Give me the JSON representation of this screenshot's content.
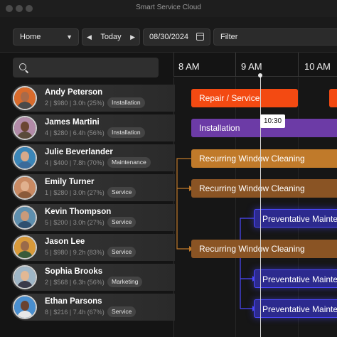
{
  "app": {
    "title": "Smart Service Cloud"
  },
  "toolbar": {
    "view_select": "Home",
    "today_label": "Today",
    "date_value": "08/30/2024",
    "filter_placeholder": "Filter"
  },
  "search": {
    "value": ""
  },
  "timeline": {
    "hours": [
      "8 AM",
      "9 AM",
      "10 AM"
    ],
    "current_time": "10:30"
  },
  "technicians": [
    {
      "name": "Andy Peterson",
      "stats": "2 | $980 | 3.0h (25%)",
      "tag": "Installation"
    },
    {
      "name": "James Martini",
      "stats": "4 | $280 | 6.4h (56%)",
      "tag": "Installation"
    },
    {
      "name": "Julie Beverlander",
      "stats": "4 | $400 | 7.8h (70%)",
      "tag": "Maintenance"
    },
    {
      "name": "Emily Turner",
      "stats": "1 | $280 | 3.0h (27%)",
      "tag": "Service"
    },
    {
      "name": "Kevin Thompson",
      "stats": "5 | $200 | 3.0h (27%)",
      "tag": "Service"
    },
    {
      "name": "Jason Lee",
      "stats": "5 | $980 | 9.2h (83%)",
      "tag": "Service"
    },
    {
      "name": "Sophia Brooks",
      "stats": "2 | $568 | 6.3h (56%)",
      "tag": "Marketing"
    },
    {
      "name": "Ethan Parsons",
      "stats": "8 | $216 | 7.4h (67%)",
      "tag": "Service"
    }
  ],
  "appointments": [
    {
      "label": "Repair / Service",
      "color": "#f34a12"
    },
    {
      "label": "Installation",
      "color": "#6c3ba6"
    },
    {
      "label": "Recurring Window Cleaning",
      "color": "#c07a2a"
    },
    {
      "label": "Recurring Window Cleaning",
      "color": "#8a5424"
    },
    {
      "label": "Preventative Maintenance",
      "color": "#2c2a8e"
    },
    {
      "label": "Recurring Window Cleaning",
      "color": "#8a5424"
    },
    {
      "label": "Preventative Maintenance",
      "color": "#2c2a8e"
    },
    {
      "label": "Preventative Maintenance",
      "color": "#2c2a8e"
    }
  ],
  "icons": {
    "window_controls": [
      "close-dot",
      "minimize-dot",
      "zoom-dot"
    ],
    "view_chevron": "chevron-down-icon",
    "nav": [
      "chevron-left-icon",
      "chevron-right-icon"
    ],
    "calendar": "calendar-icon",
    "search": "search-icon"
  }
}
